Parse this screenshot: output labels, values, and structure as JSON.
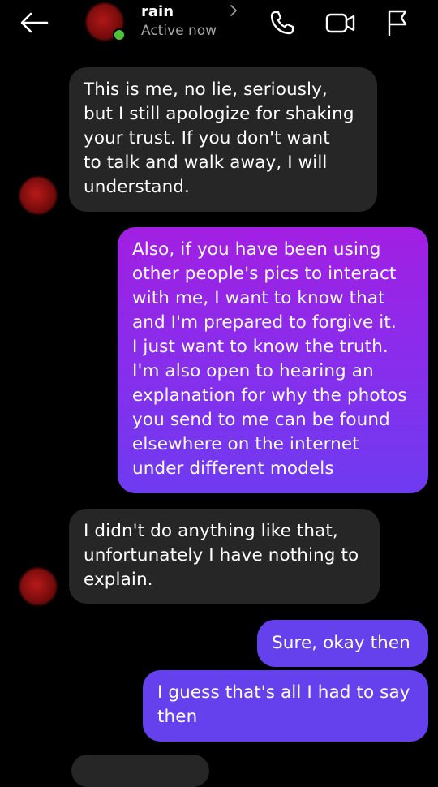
{
  "header": {
    "contact_name": "rain",
    "status": "Active now"
  },
  "colors": {
    "background": "#000000",
    "incoming_bubble": "#262626",
    "outgoing_gradient_top": "#a020e0",
    "outgoing_gradient_bottom": "#6a3cf0",
    "outgoing_solid": "#6541ee",
    "online": "#4fc23a"
  },
  "messages": [
    {
      "direction": "incoming",
      "text": "This is me, no lie, seriously,\nbut I still apologize for shaking\nyour trust. If you don't want\nto talk and walk away, I will\nunderstand."
    },
    {
      "direction": "outgoing",
      "text": "Also, if you have been using\nother people's pics to interact\nwith me, I want to know that\nand I'm prepared to forgive it.\nI just want to know the truth.\nI'm also open to hearing an\nexplanation for why the photos\nyou send to me can be found\nelsewhere on the internet\nunder different models"
    },
    {
      "direction": "incoming",
      "text": "I didn't do anything like that,\nunfortunately I have nothing to\nexplain."
    },
    {
      "direction": "outgoing",
      "text": "Sure, okay then"
    },
    {
      "direction": "outgoing",
      "text": "I guess that's all I had to say\nthen"
    }
  ]
}
